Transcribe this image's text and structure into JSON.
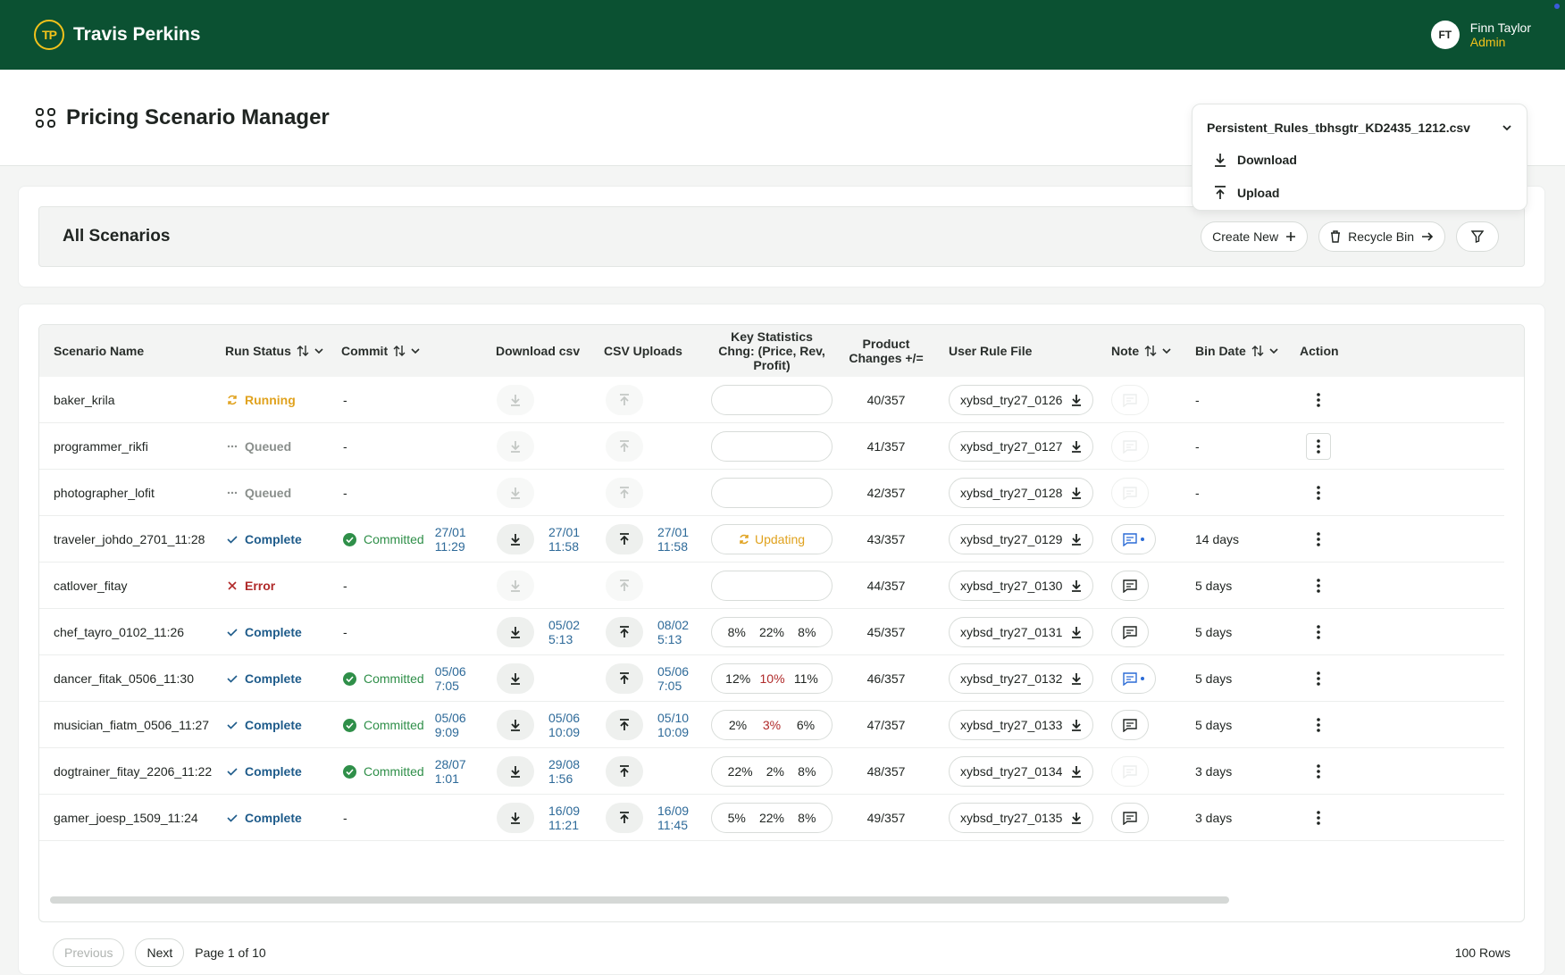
{
  "app": {
    "brand": "Travis Perkins",
    "logo_text": "TP"
  },
  "user": {
    "initials": "FT",
    "name": "Finn Taylor",
    "role": "Admin"
  },
  "page": {
    "title": "Pricing Scenario Manager"
  },
  "file_menu": {
    "selected": "Persistent_Rules_tbhsgtr_KD2435_1212.csv",
    "items": [
      "Download",
      "Upload"
    ]
  },
  "scenarios_bar": {
    "title": "All Scenarios",
    "create_new": "Create New",
    "recycle_bin": "Recycle Bin"
  },
  "table": {
    "headers": {
      "name": "Scenario Name",
      "run_status": "Run Status",
      "commit": "Commit",
      "download": "Download csv",
      "uploads": "CSV Uploads",
      "stats": "Key Statistics Chng: (Price, Rev, Profit)",
      "product_changes": "Product Changes +/=",
      "rule_file": "User Rule File",
      "note": "Note",
      "bin_date": "Bin Date",
      "action": "Action"
    },
    "rows": [
      {
        "name": "baker_krila",
        "status": "Running",
        "commit": "-",
        "commit_date": "",
        "dl_date": "",
        "up_date": "",
        "stats": [],
        "updating": false,
        "changes": "40/357",
        "rule": "xybsd_try27_0126",
        "note": "faint",
        "bin": "-",
        "dl_enabled": false,
        "up_enabled": false
      },
      {
        "name": "programmer_rikfi",
        "status": "Queued",
        "commit": "-",
        "commit_date": "",
        "dl_date": "",
        "up_date": "",
        "stats": [],
        "updating": false,
        "changes": "41/357",
        "rule": "xybsd_try27_0127",
        "note": "faint",
        "bin": "-",
        "dl_enabled": false,
        "up_enabled": false
      },
      {
        "name": "photographer_lofit",
        "status": "Queued",
        "commit": "-",
        "commit_date": "",
        "dl_date": "",
        "up_date": "",
        "stats": [],
        "updating": false,
        "changes": "42/357",
        "rule": "xybsd_try27_0128",
        "note": "faint",
        "bin": "-",
        "dl_enabled": false,
        "up_enabled": false
      },
      {
        "name": "traveler_johdo_2701_11:28",
        "status": "Complete",
        "commit": "Committed",
        "commit_date": "27/01 11:29",
        "dl_date": "27/01 11:58",
        "up_date": "27/01 11:58",
        "stats": [],
        "updating": true,
        "changes": "43/357",
        "rule": "xybsd_try27_0129",
        "note": "blue",
        "bin": "14 days",
        "dl_enabled": true,
        "up_enabled": true
      },
      {
        "name": "catlover_fitay",
        "status": "Error",
        "commit": "-",
        "commit_date": "",
        "dl_date": "",
        "up_date": "",
        "stats": [],
        "updating": false,
        "changes": "44/357",
        "rule": "xybsd_try27_0130",
        "note": "normal",
        "bin": "5 days",
        "dl_enabled": false,
        "up_enabled": false
      },
      {
        "name": "chef_tayro_0102_11:26",
        "status": "Complete",
        "commit": "-",
        "commit_date": "",
        "dl_date": "05/02 5:13",
        "up_date": "08/02 5:13",
        "stats": [
          "8%",
          "22%",
          "8%"
        ],
        "updating": false,
        "changes": "45/357",
        "rule": "xybsd_try27_0131",
        "note": "normal",
        "bin": "5 days",
        "dl_enabled": true,
        "up_enabled": true
      },
      {
        "name": "dancer_fitak_0506_11:30",
        "status": "Complete",
        "commit": "Committed",
        "commit_date": "05/06 7:05",
        "dl_date": "",
        "up_date": "05/06 7:05",
        "stats": [
          "12%",
          "10%",
          "11%"
        ],
        "updating": false,
        "changes": "46/357",
        "rule": "xybsd_try27_0132",
        "note": "blue",
        "bin": "5 days",
        "dl_enabled": true,
        "up_enabled": true
      },
      {
        "name": "musician_fiatm_0506_11:27",
        "status": "Complete",
        "commit": "Committed",
        "commit_date": "05/06 9:09",
        "dl_date": "05/06 10:09",
        "up_date": "05/10 10:09",
        "stats": [
          "2%",
          "3%",
          "6%"
        ],
        "updating": false,
        "changes": "47/357",
        "rule": "xybsd_try27_0133",
        "note": "normal",
        "bin": "5 days",
        "dl_enabled": true,
        "up_enabled": true
      },
      {
        "name": "dogtrainer_fitay_2206_11:22",
        "status": "Complete",
        "commit": "Committed",
        "commit_date": "28/07 1:01",
        "dl_date": "29/08 1:56",
        "up_date": "",
        "stats": [
          "22%",
          "2%",
          "8%"
        ],
        "updating": false,
        "changes": "48/357",
        "rule": "xybsd_try27_0134",
        "note": "faint",
        "bin": "3 days",
        "dl_enabled": true,
        "up_enabled": true
      },
      {
        "name": "gamer_joesp_1509_11:24",
        "status": "Complete",
        "commit": "-",
        "commit_date": "",
        "dl_date": "16/09 11:21",
        "up_date": "16/09 11:45",
        "stats": [
          "5%",
          "22%",
          "8%"
        ],
        "updating": false,
        "changes": "49/357",
        "rule": "xybsd_try27_0135",
        "note": "normal",
        "bin": "3 days",
        "dl_enabled": true,
        "up_enabled": true
      }
    ],
    "updating_label": "Updating"
  },
  "pagination": {
    "previous": "Previous",
    "next": "Next",
    "page": "Page 1 of 10",
    "rows": "100 Rows"
  },
  "colors": {
    "brand_green": "#0b5132",
    "accent_yellow": "#f2c21b",
    "committed_green": "#2f8f49",
    "error_red": "#b02a2a",
    "link_blue": "#2e6a99"
  }
}
